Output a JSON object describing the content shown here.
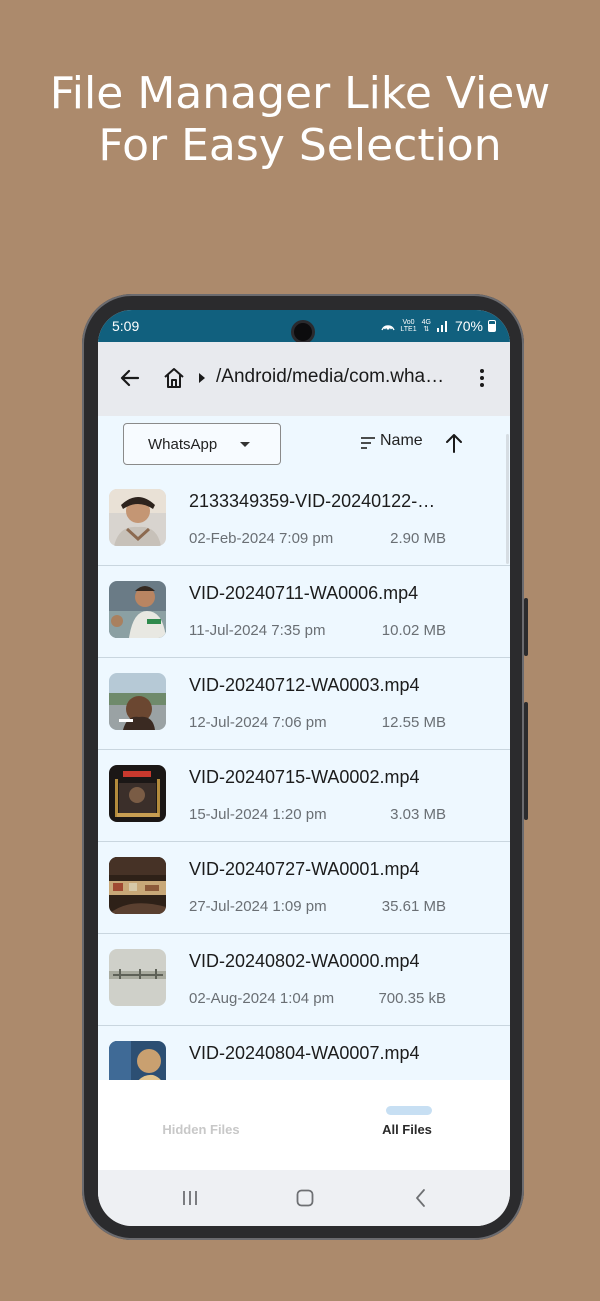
{
  "promo": {
    "line1": "File Manager Like View",
    "line2": "For Easy Selection"
  },
  "status": {
    "time": "5:09",
    "battery": "70%",
    "network_top": "Vo0",
    "network_bottom": "LTE1",
    "gen": "4G"
  },
  "appbar": {
    "back_icon": "arrow-left-icon",
    "home_icon": "home-icon",
    "path": "/Android/media/com.wha…",
    "more_icon": "more-vert-icon"
  },
  "toolbar": {
    "folder_filter": "WhatsApp",
    "sort_label": "Name",
    "sort_direction": "ascending"
  },
  "files": [
    {
      "name": "2133349359-VID-20240122-…",
      "date": "02-Feb-2024 7:09 pm",
      "size": "2.90 MB"
    },
    {
      "name": "VID-20240711-WA0006.mp4",
      "date": "11-Jul-2024 7:35 pm",
      "size": "10.02 MB"
    },
    {
      "name": "VID-20240712-WA0003.mp4",
      "date": "12-Jul-2024 7:06 pm",
      "size": "12.55 MB"
    },
    {
      "name": "VID-20240715-WA0002.mp4",
      "date": "15-Jul-2024 1:20 pm",
      "size": "3.03 MB"
    },
    {
      "name": "VID-20240727-WA0001.mp4",
      "date": "27-Jul-2024 1:09 pm",
      "size": "35.61 MB"
    },
    {
      "name": "VID-20240802-WA0000.mp4",
      "date": "02-Aug-2024 1:04 pm",
      "size": "700.35 kB"
    },
    {
      "name": "VID-20240804-WA0007.mp4",
      "date": "",
      "size": ""
    }
  ],
  "tabs": {
    "hidden": "Hidden Files",
    "all": "All Files",
    "active": "all"
  },
  "colors": {
    "background": "#ac8a6c",
    "statusbar": "#11607e",
    "list_bg": "#eef8ff"
  }
}
